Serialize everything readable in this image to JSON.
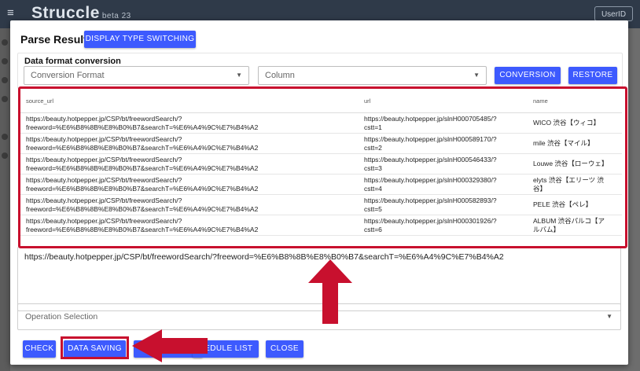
{
  "app": {
    "title": "Struccle",
    "beta": "beta 23",
    "menu_icon": "hamburger-menu-icon",
    "userid_label": "UserID"
  },
  "dialog": {
    "title": "Parse Result",
    "display_switch_label": "DISPLAY TYPE SWITCHING",
    "conversion": {
      "title": "Data format conversion",
      "format_placeholder": "Conversion Format",
      "column_placeholder": "Column",
      "conversion_label": "CONVERSION",
      "restore_label": "RESTORE"
    },
    "table": {
      "headers": [
        "source_url",
        "url",
        "name"
      ],
      "rows": [
        [
          "https://beauty.hotpepper.jp/CSP/bt/freewordSearch/?\nfreeword=%E6%B8%8B%E8%B0%B7&searchT=%E6%A4%9C%E7%B4%A2",
          "https://beauty.hotpepper.jp/slnH000705485/?\ncstt=1",
          "WICO 渋谷【ウィコ】"
        ],
        [
          "https://beauty.hotpepper.jp/CSP/bt/freewordSearch/?\nfreeword=%E6%B8%8B%E8%B0%B7&searchT=%E6%A4%9C%E7%B4%A2",
          "https://beauty.hotpepper.jp/slnH000589170/?\ncstt=2",
          "mile 渋谷【マイル】"
        ],
        [
          "https://beauty.hotpepper.jp/CSP/bt/freewordSearch/?\nfreeword=%E6%B8%8B%E8%B0%B7&searchT=%E6%A4%9C%E7%B4%A2",
          "https://beauty.hotpepper.jp/slnH000546433/?\ncstt=3",
          "Louwe 渋谷【ローウェ】"
        ],
        [
          "https://beauty.hotpepper.jp/CSP/bt/freewordSearch/?\nfreeword=%E6%B8%8B%E8%B0%B7&searchT=%E6%A4%9C%E7%B4%A2",
          "https://beauty.hotpepper.jp/slnH000329380/?\ncstt=4",
          "elyts 渋谷【エリーツ 渋\n谷】"
        ],
        [
          "https://beauty.hotpepper.jp/CSP/bt/freewordSearch/?\nfreeword=%E6%B8%8B%E8%B0%B7&searchT=%E6%A4%9C%E7%B4%A2",
          "https://beauty.hotpepper.jp/slnH000582893/?\ncstt=5",
          "PELE 渋谷【ペレ】"
        ],
        [
          "https://beauty.hotpepper.jp/CSP/bt/freewordSearch/?\nfreeword=%E6%B8%8B%E8%B0%B7&searchT=%E6%A4%9C%E7%B4%A2",
          "https://beauty.hotpepper.jp/slnH000301926/?\ncstt=6",
          "ALBUM 渋谷パルコ【ア\nルバム】"
        ]
      ]
    },
    "textarea_value": "https://beauty.hotpepper.jp/CSP/bt/freewordSearch/?freeword=%E6%B8%8B%E8%B0%B7&searchT=%E6%A4%9C%E7%B4%A2",
    "operation_placeholder": "Operation Selection",
    "buttons": {
      "check": "CHECK",
      "data_saving": "DATA SAVING",
      "schedule_list": "HEDULE LIST",
      "close": "CLOSE"
    }
  },
  "colors": {
    "accent": "#3d5afe",
    "highlight": "#c8102e",
    "topbar": "#2f3a49"
  }
}
